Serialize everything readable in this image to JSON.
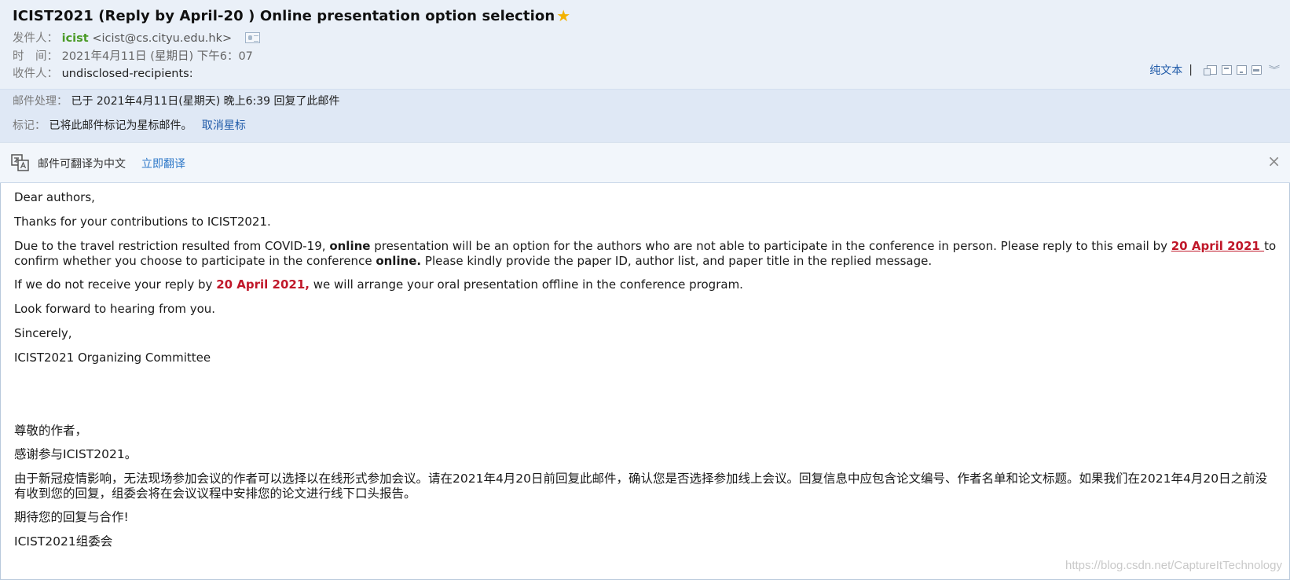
{
  "header": {
    "subject": "ICIST2021 (Reply by April-20 ) Online presentation option selection",
    "star_icon": "★",
    "sender_label": "发件人：",
    "sender_name": "icist",
    "sender_address": "<icist@cs.cityu.edu.hk>",
    "time_label": "时　间：",
    "time_value": "2021年4月11日 (星期日) 下午6：07",
    "recipient_label": "收件人：",
    "recipient_value": "undisclosed-recipients:",
    "tools": {
      "plaintext_label": "纯文本",
      "separator": "|",
      "icons": [
        "popout-icon",
        "document-icon",
        "download-icon",
        "print-icon",
        "chevron-down-icon"
      ]
    }
  },
  "status": {
    "processing_label": "邮件处理：",
    "processing_value": "已于 2021年4月11日(星期天) 晚上6:39 回复了此邮件",
    "flag_label": "标记：",
    "flag_value": "已将此邮件标记为星标邮件。",
    "unstar_label": "取消星标"
  },
  "translate": {
    "text": "邮件可翻译为中文",
    "link": "立即翻译",
    "close": "×"
  },
  "body": {
    "greeting": "Dear authors,",
    "thanks": "Thanks for your contributions to ICIST2021.",
    "p1_a": "Due to the travel restriction  resulted from COVID-19, ",
    "p1_online": "online",
    "p1_b": " presentation will be an option for the authors who are not able to participate in the conference in person. Please reply to this email by ",
    "p1_date": "20 April 2021 ",
    "p1_c": "to confirm whether you choose to participate in the conference ",
    "p1_online2": "online.",
    "p1_d": " Please kindly provide the paper ID, author list, and paper title in the replied message.",
    "p2_a": "If we do not receive your reply by ",
    "p2_date": "20 April 2021,",
    "p2_b": " we will arrange your oral presentation offline in the conference program.",
    "lookforward": "Look forward to hearing from you.",
    "sincerely": "Sincerely,",
    "signature": "ICIST2021 Organizing Committee",
    "cn_greeting": "尊敬的作者，",
    "cn_thanks": "感谢参与ICIST2021。",
    "cn_p1": "由于新冠疫情影响，无法现场参加会议的作者可以选择以在线形式参加会议。请在2021年4月20日前回复此邮件，确认您是否选择参加线上会议。回复信息中应包含论文编号、作者名单和论文标题。如果我们在2021年4月20日之前没有收到您的回复，组委会将在会议议程中安排您的论文进行线下口头报告。",
    "cn_lookforward": "期待您的回复与合作!",
    "cn_signature": "ICIST2021组委会"
  },
  "watermark": "https://blog.csdn.net/CaptureItTechnology"
}
